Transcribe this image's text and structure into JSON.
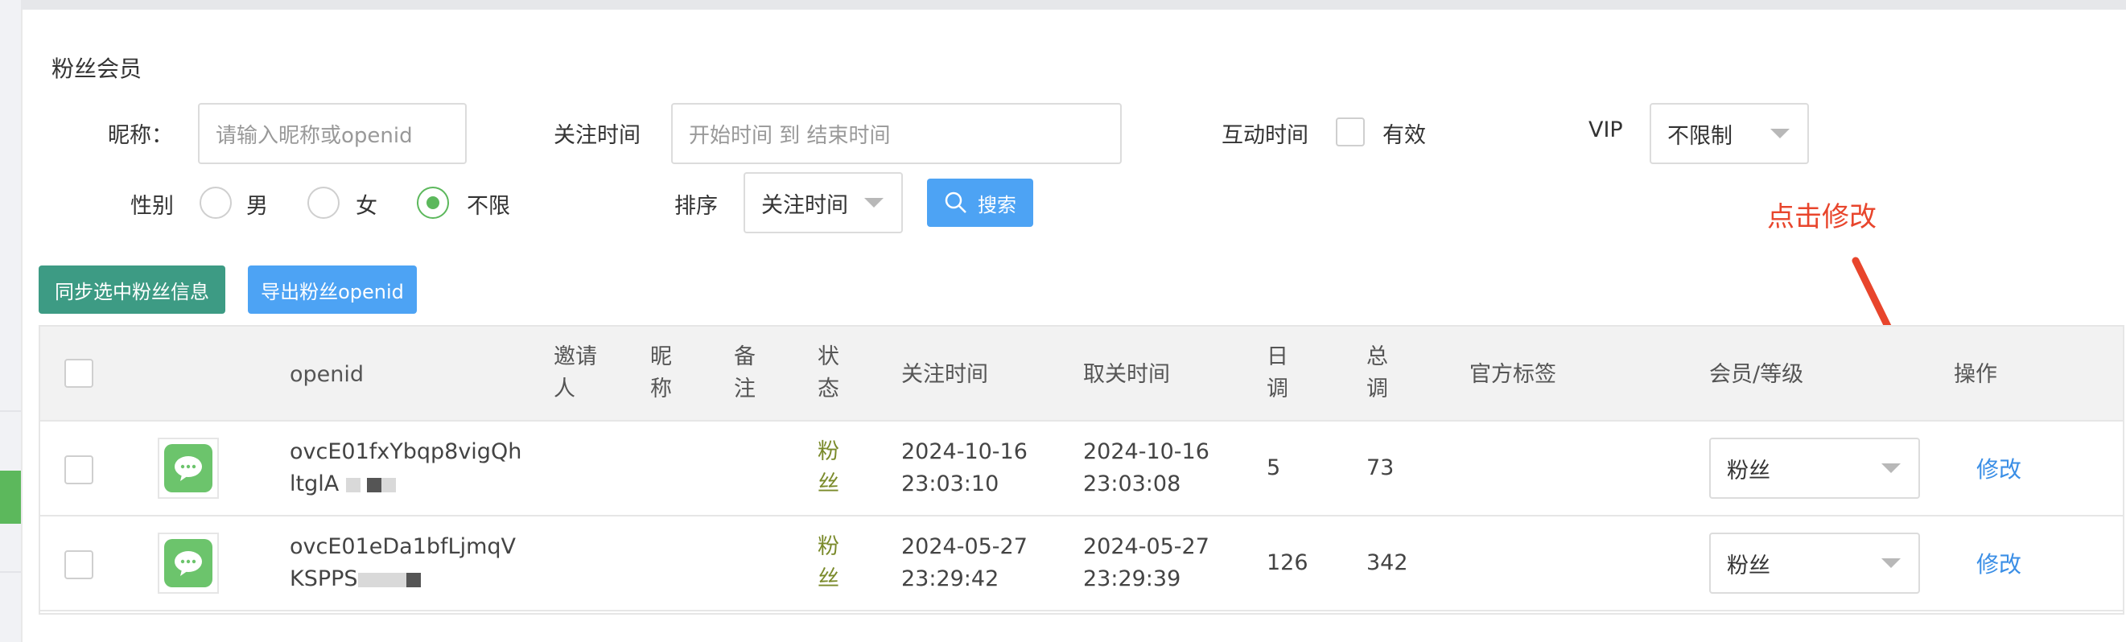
{
  "page_title": "粉丝会员",
  "filters": {
    "nickname_label": "昵称：",
    "nickname_placeholder": "请输入昵称或openid",
    "follow_time_label": "关注时间",
    "follow_time_placeholder": "开始时间 到 结束时间",
    "interact_time_label": "互动时间",
    "interact_valid_label": "有效",
    "vip_label": "VIP",
    "vip_value": "不限制",
    "gender_label": "性别",
    "gender_options": [
      "男",
      "女",
      "不限"
    ],
    "gender_selected": "不限",
    "sort_label": "排序",
    "sort_value": "关注时间",
    "search_button": "搜索"
  },
  "actions": {
    "sync_button": "同步选中粉丝信息",
    "export_button": "导出粉丝openid"
  },
  "annotation": {
    "text": "点击修改",
    "color": "#e8452c"
  },
  "table": {
    "headers": {
      "openid": "openid",
      "inviter": [
        "邀请",
        "人"
      ],
      "nickname": [
        "昵",
        "称"
      ],
      "remark": [
        "备",
        "注"
      ],
      "status": [
        "状",
        "态"
      ],
      "follow_time": "关注时间",
      "unfollow_time": "取关时间",
      "daily": [
        "日",
        "调"
      ],
      "total": [
        "总",
        "调"
      ],
      "official_tags": "官方标签",
      "member_level": "会员/等级",
      "operation": "操作"
    },
    "rows": [
      {
        "openid_line1": "ovcE01fxYbqp8vigQh",
        "openid_line2": "ltglA",
        "status": [
          "粉",
          "丝"
        ],
        "follow_date": "2024-10-16",
        "follow_time": "23:03:10",
        "unfollow_date": "2024-10-16",
        "unfollow_time": "23:03:08",
        "daily": "5",
        "total": "73",
        "level": "粉丝",
        "operation": "修改"
      },
      {
        "openid_line1": "ovcE01eDa1bfLjmqV",
        "openid_line2": "KSPPS",
        "status": [
          "粉",
          "丝"
        ],
        "follow_date": "2024-05-27",
        "follow_time": "23:29:42",
        "unfollow_date": "2024-05-27",
        "unfollow_time": "23:29:39",
        "daily": "126",
        "total": "342",
        "level": "粉丝",
        "operation": "修改"
      }
    ]
  },
  "colors": {
    "accent_green": "#5cb85c",
    "teal_button": "#3d9b84",
    "blue_button": "#4da3f4",
    "link": "#3a8ee6"
  }
}
